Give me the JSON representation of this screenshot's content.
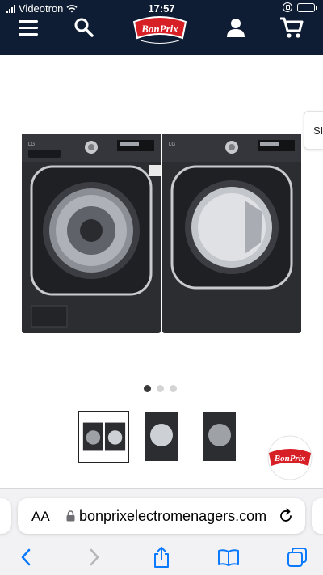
{
  "status_bar": {
    "carrier": "Videotron",
    "time": "17:57"
  },
  "header": {
    "logo_text": "BonPrix",
    "menu_icon": "hamburger-menu-icon",
    "search_icon": "search-icon",
    "account_icon": "user-icon",
    "cart_icon": "cart-icon"
  },
  "product_gallery": {
    "main_image": "LG front-load washer and dryer pair, black steel",
    "side_tab_label": "SI",
    "carousel": {
      "slide_count": 3,
      "active_index": 0
    },
    "thumbnails": [
      {
        "alt": "washer-dryer-pair",
        "selected": true
      },
      {
        "alt": "dryer",
        "selected": false
      },
      {
        "alt": "washer",
        "selected": false
      }
    ]
  },
  "floating_badge": {
    "text": "BonPrix"
  },
  "browser": {
    "text_size_label": "AA",
    "url": "bonprixelectromenagers.com",
    "toolbar": {
      "back_icon": "back-chevron-icon",
      "forward_icon": "forward-chevron-icon",
      "share_icon": "share-icon",
      "bookmarks_icon": "bookmarks-icon",
      "tabs_icon": "tabs-icon"
    }
  },
  "colors": {
    "header_bg": "#0e1d33",
    "brand_red": "#d71f26",
    "safari_blue": "#0a7aff",
    "battery_green": "#35c759"
  }
}
